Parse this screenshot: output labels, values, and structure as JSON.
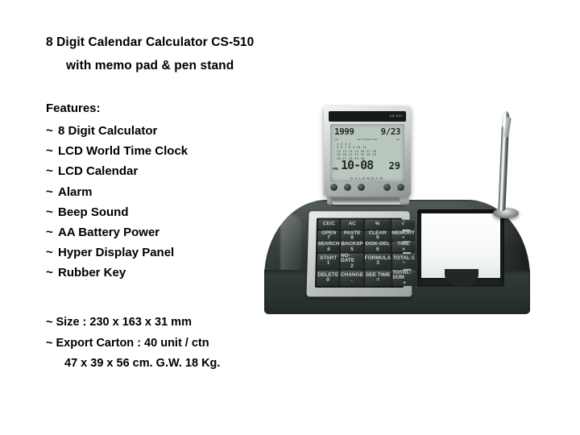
{
  "product": {
    "title_line1": "8 Digit Calendar Calculator  CS-510",
    "title_line2": "with memo pad & pen stand",
    "features_heading": "Features:",
    "features": [
      "8 Digit Calculator",
      "LCD World Time Clock",
      "LCD Calendar",
      "Alarm",
      "Beep Sound",
      "AA Battery Power",
      "Hyper Display Panel",
      "Rubber Key"
    ],
    "bullet_marker": "~",
    "specs": [
      {
        "text": "~ Size : 230 x 163 x 31 mm",
        "indent": false
      },
      {
        "text": "~ Export Carton :  40 unit / ctn",
        "indent": false
      },
      {
        "text": "47 x 39 x 56 cm.  G.W. 18 Kg.",
        "indent": true
      }
    ]
  },
  "device": {
    "brand_mark": "CS-510",
    "lcd": {
      "year": "1999",
      "date": "9/23",
      "mini_labels": [
        "SU",
        "MO TU WE TH FR",
        "SA"
      ],
      "calendar_rows": [
        "        1  2  3  4",
        "5  6  7  8  9 10 11",
        "12 13 14 15 16 17 18",
        "19 20 21 22 23 24 25",
        "26 27 28 29 30"
      ],
      "ampm": "PM",
      "time": "10-08",
      "seconds": "29",
      "mode_label": "CALENDAR"
    },
    "lcd_buttons": [
      "mode-button",
      "set-button",
      "adjust-button",
      "alarm-button",
      "light-button"
    ],
    "keypad": [
      {
        "top": "",
        "main": "CE/C"
      },
      {
        "top": "",
        "main": "AC"
      },
      {
        "top": "",
        "main": "%"
      },
      {
        "top": "",
        "main": "√"
      },
      {
        "top": "OPEN",
        "main": "7"
      },
      {
        "top": "PASTE",
        "main": "8"
      },
      {
        "top": "CLEAR",
        "main": "9"
      },
      {
        "top": "MEMORY",
        "main": "÷"
      },
      {
        "top": "SEARCH",
        "main": "4"
      },
      {
        "top": "BACKSP",
        "main": "5"
      },
      {
        "top": "DISK-DEL",
        "main": "6"
      },
      {
        "top": "TIME",
        "main": "×"
      },
      {
        "top": "START",
        "main": "1"
      },
      {
        "top": "NO-DATE",
        "main": "2"
      },
      {
        "top": "FORMULA",
        "main": "3"
      },
      {
        "top": "TOTAL-1",
        "main": "−"
      },
      {
        "top": "DELETE",
        "main": "0"
      },
      {
        "top": "CHANGE",
        "main": "."
      },
      {
        "top": "SEE TIME",
        "main": "="
      },
      {
        "top": "TOTAL-SUM",
        "main": "+"
      }
    ],
    "memo_pad_label": "memo-pad",
    "pen_label": "pen"
  },
  "colors": {
    "background": "#ffffff",
    "text": "#000000",
    "base_dark": "#2d3633",
    "silver": "#c6cbcb",
    "lcd_green": "#bac7bf",
    "key_dark": "#2e3634",
    "paper_white": "#ffffff"
  }
}
